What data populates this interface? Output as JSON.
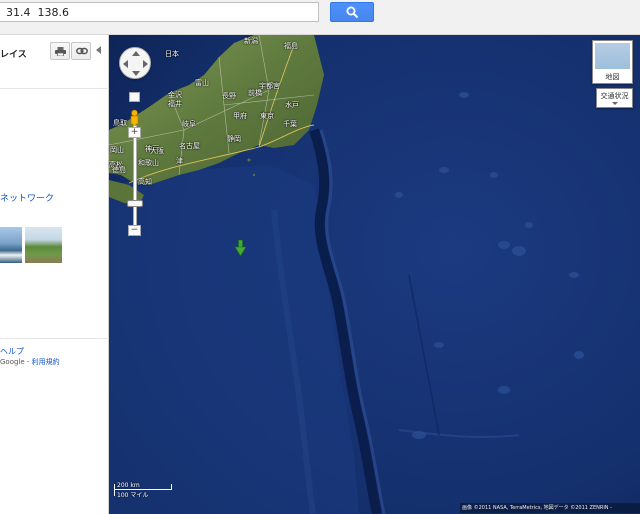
{
  "search": {
    "value": "31.4  138.6"
  },
  "panel": {
    "places_label": "レイス",
    "network_label": "ネットワーク",
    "help_label": "ヘルプ",
    "google_label": "Google -",
    "terms_label": "利用規約"
  },
  "map": {
    "type_label": "地図",
    "traffic_label": "交通状況",
    "scale_km": "200 km",
    "scale_mi": "100 マイル",
    "attribution": "画像 ©2011 NASA, TerraMetrics, 地図データ ©2011 ZENRIN -",
    "labels": [
      {
        "name": "label-nihon",
        "text": "日本"
      },
      {
        "name": "label-niigata",
        "text": "新潟"
      },
      {
        "name": "label-fukushima",
        "text": "福島"
      },
      {
        "name": "label-kanazawa",
        "text": "金沢"
      },
      {
        "name": "label-toyama",
        "text": "富山"
      },
      {
        "name": "label-fukui",
        "text": "福井"
      },
      {
        "name": "label-nagano",
        "text": "長野"
      },
      {
        "name": "label-maebashi",
        "text": "前橋"
      },
      {
        "name": "label-utsunomiya",
        "text": "宇都宮"
      },
      {
        "name": "label-mito",
        "text": "水戸"
      },
      {
        "name": "label-tottori",
        "text": "鳥取"
      },
      {
        "name": "label-gifu",
        "text": "岐阜"
      },
      {
        "name": "label-kofu",
        "text": "甲府"
      },
      {
        "name": "label-tokyo",
        "text": "東京"
      },
      {
        "name": "label-chiba",
        "text": "千葉"
      },
      {
        "name": "label-okayama",
        "text": "岡山"
      },
      {
        "name": "label-kobe",
        "text": "神戸"
      },
      {
        "name": "label-nagoya",
        "text": "名古屋"
      },
      {
        "name": "label-shizuoka",
        "text": "静岡"
      },
      {
        "name": "label-osaka",
        "text": "大阪"
      },
      {
        "name": "label-takamatsu",
        "text": "高松"
      },
      {
        "name": "label-wakayama",
        "text": "和歌山"
      },
      {
        "name": "label-tsu",
        "text": "津"
      },
      {
        "name": "label-tokushima",
        "text": "徳島"
      },
      {
        "name": "label-kochi",
        "text": "高知"
      }
    ]
  },
  "colors": {
    "ocean": "#14306e",
    "ocean_deep": "#0c2157",
    "land": "#6e8a46",
    "marker": "#3eaa34",
    "accent_blue": "#4d90fe"
  },
  "icons": [
    "search-icon",
    "print-icon",
    "link-icon",
    "pegman-icon",
    "marker-icon"
  ]
}
